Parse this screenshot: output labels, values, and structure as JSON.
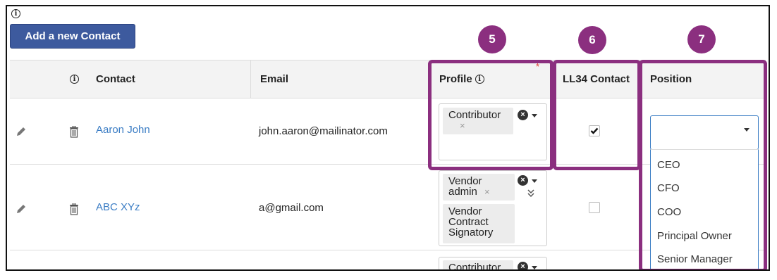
{
  "toolbar": {
    "add_label": "Add a new Contact"
  },
  "table": {
    "headers": {
      "contact": "Contact",
      "email": "Email",
      "profile": "Profile",
      "ll34": "LL34 Contact",
      "position": "Position"
    },
    "rows": [
      {
        "contact": "Aaron John",
        "email": "john.aaron@mailinator.com",
        "ll34_checked": true,
        "profiles": [
          {
            "label": "Contributor",
            "remove": "×"
          }
        ]
      },
      {
        "contact": "ABC XYz",
        "email": "a@gmail.com",
        "ll34_checked": false,
        "profiles": [
          {
            "label1": "Vendor",
            "label2": "admin",
            "remove": "×"
          },
          {
            "label1": "Vendor",
            "label2": "Contract",
            "label3": "Signatory"
          }
        ]
      },
      {
        "profiles": [
          {
            "label": "Contributor"
          }
        ]
      }
    ]
  },
  "position_select": {
    "value": "",
    "options": [
      "CEO",
      "CFO",
      "COO",
      "Principal Owner",
      "Senior Manager"
    ]
  },
  "callouts": {
    "profile": "5",
    "ll34": "6",
    "position": "7"
  },
  "colors": {
    "accent": "#3d5a9e",
    "link": "#3a7cc4",
    "callout": "#8b2f7f"
  }
}
